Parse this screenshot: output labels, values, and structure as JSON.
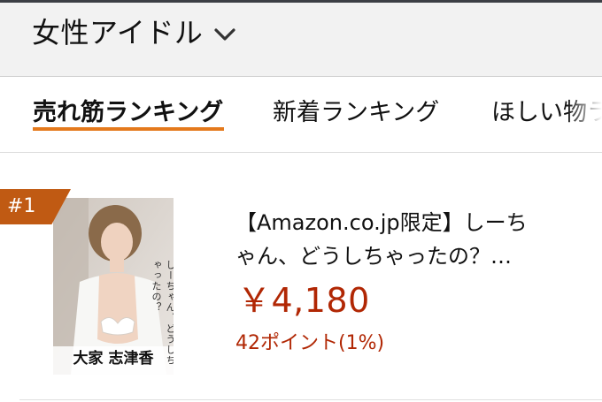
{
  "header": {
    "category_title": "女性アイドル",
    "chevron_icon": "chevron-down-icon"
  },
  "tabs": [
    {
      "label": "売れ筋ランキング",
      "active": true
    },
    {
      "label": "新着ランキング",
      "active": false
    },
    {
      "label": "ほしい物ラ",
      "active": false
    }
  ],
  "accent_color": "#e4791c",
  "price_color": "#b12704",
  "product": {
    "rank": "#1",
    "title_line1": "【Amazon.co.jp限定】しーち",
    "title_line2": "ゃん、どうしちゃったの？…",
    "price": "￥4,180",
    "points": "42ポイント(1%)",
    "cover_name": "大家 志津香",
    "cover_vertical_text": "しーちゃん、どうしちゃったの？"
  }
}
